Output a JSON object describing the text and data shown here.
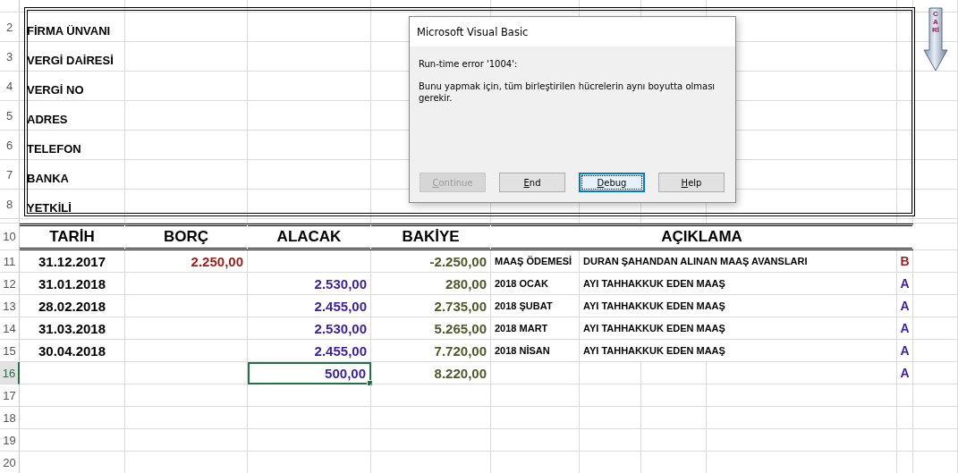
{
  "sheet": {
    "info_rows": [
      {
        "number": "2",
        "label": "FİRMA ÜNVANI"
      },
      {
        "number": "3",
        "label": "VERGİ DAİRESİ"
      },
      {
        "number": "4",
        "label": "VERGİ NO"
      },
      {
        "number": "5",
        "label": "ADRES"
      },
      {
        "number": "6",
        "label": "TELEFON"
      },
      {
        "number": "7",
        "label": "BANKA"
      },
      {
        "number": "8",
        "label": "YETKİLİ"
      }
    ],
    "header": {
      "number": "10",
      "columns": [
        "TARİH",
        "BORÇ",
        "ALACAK",
        "BAKİYE",
        "AÇIKLAMA"
      ]
    },
    "rows": [
      {
        "number": "11",
        "date": "31.12.2017",
        "debit": "2.250,00",
        "balance": "-2.250,00",
        "note": "MAAŞ ÖDEMESİ",
        "description": "DURAN ŞAHANDAN ALINAN MAAŞ AVANSLARI",
        "code": "B",
        "color": "#9c1c1c",
        "selected": false
      },
      {
        "number": "12",
        "date": "31.01.2018",
        "credit": "2.530,00",
        "balance": "280,00",
        "note": "2018 OCAK",
        "description": "AYI TAHHAKKUK EDEN MAAŞ",
        "code": "A",
        "color": "#3a1f9e",
        "selected": false
      },
      {
        "number": "13",
        "date": "28.02.2018",
        "credit": "2.455,00",
        "balance": "2.735,00",
        "note": "2018 ŞUBAT",
        "description": "AYI TAHHAKKUK EDEN MAAŞ",
        "code": "A",
        "color": "#3a1f9e",
        "selected": false
      },
      {
        "number": "14",
        "date": "31.03.2018",
        "credit": "2.530,00",
        "balance": "5.265,00",
        "note": "2018 MART",
        "description": "AYI TAHHAKKUK EDEN MAAŞ",
        "code": "A",
        "color": "#3a1f9e",
        "selected": false
      },
      {
        "number": "15",
        "date": "30.04.2018",
        "credit": "2.455,00",
        "balance": "7.720,00",
        "note": "2018 NİSAN",
        "description": "AYI TAHHAKKUK EDEN MAAŞ",
        "code": "A",
        "color": "#3a1f9e",
        "selected": false
      },
      {
        "number": "16",
        "credit": "500,00",
        "balance": "8.220,00",
        "code": "A",
        "color": "#3a1f9e",
        "selected": true
      }
    ],
    "empty_rows": [
      {
        "number": "17"
      },
      {
        "number": "18"
      },
      {
        "number": "19"
      },
      {
        "number": "20"
      }
    ],
    "arrow": {
      "label": "CARİ"
    }
  },
  "dialog": {
    "title": "Microsoft Visual Basic",
    "error": "Run-time error '1004':",
    "message": "Bunu yapmak için, tüm birleştirilen hücrelerin aynı boyutta olması gerekir.",
    "buttons": [
      {
        "label": "Continue",
        "disabled": true,
        "default": false
      },
      {
        "label": "End",
        "disabled": false,
        "default": false
      },
      {
        "label": "Debug",
        "disabled": false,
        "default": true
      },
      {
        "label": "Help",
        "disabled": false,
        "default": false
      }
    ]
  }
}
